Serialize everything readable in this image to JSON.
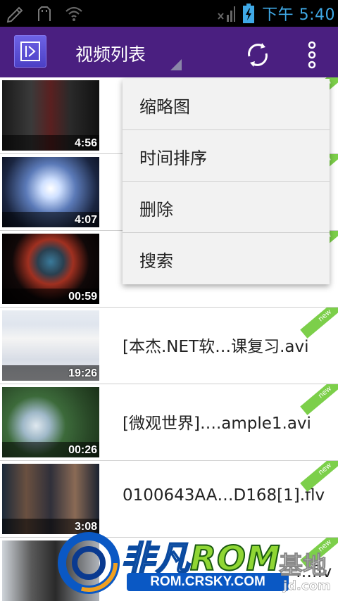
{
  "status_bar": {
    "time": "下午 5:40",
    "icons": [
      "edit-icon",
      "usb-icon",
      "wifi-icon",
      "no-signal-icon",
      "battery-charging-icon"
    ]
  },
  "action_bar": {
    "title": "视频列表",
    "icons": [
      "app-logo-icon",
      "refresh-icon",
      "overflow-menu-icon"
    ]
  },
  "popup_menu": {
    "items": [
      {
        "label": "缩略图"
      },
      {
        "label": "时间排序"
      },
      {
        "label": "删除"
      },
      {
        "label": "搜索"
      }
    ]
  },
  "videos": [
    {
      "name": "",
      "duration": "4:56",
      "badge": "new"
    },
    {
      "name": "",
      "duration": "4:07",
      "badge": "new"
    },
    {
      "name": "",
      "duration": "00:59",
      "badge": "new"
    },
    {
      "name": "[本杰.NET软…课复习.avi",
      "duration": "19:26",
      "badge": "new"
    },
    {
      "name": "[微观世界]….ample1.avi",
      "duration": "00:26",
      "badge": "new"
    },
    {
      "name": "0100643AA…D168[1].flv",
      "duration": "3:08",
      "badge": "new"
    },
    {
      "name": "…flv",
      "duration": "",
      "badge": "new"
    }
  ],
  "watermark": {
    "title_a": "非凡",
    "title_b": "ROM",
    "subtitle": "ROM.CRSKY.COM",
    "right_text": "基地",
    "domain": "jd.com"
  },
  "colors": {
    "action_bar": "#4a1f80",
    "status_text": "#3fa9e6",
    "new_badge": "#7ccf4a"
  }
}
